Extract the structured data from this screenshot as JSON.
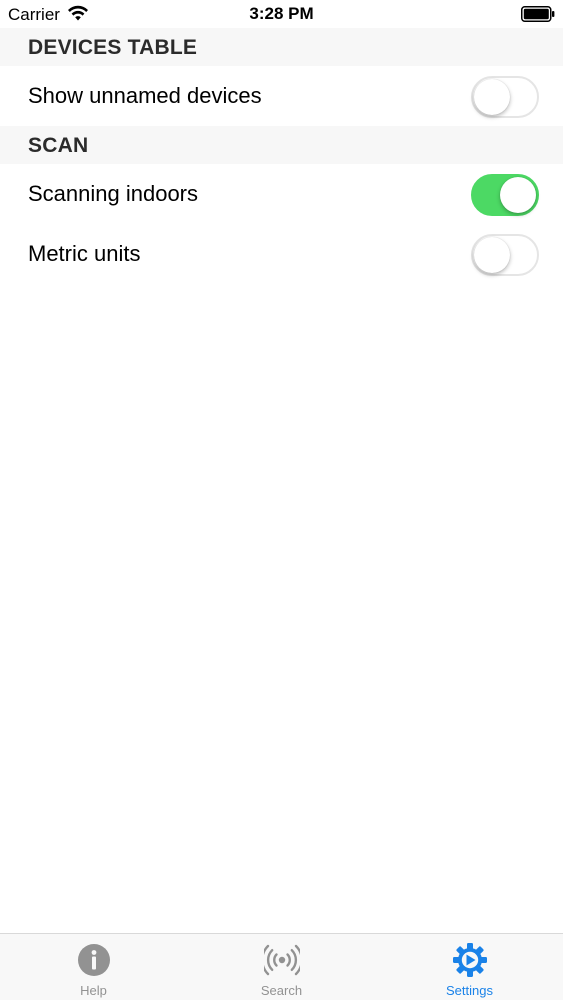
{
  "status_bar": {
    "carrier": "Carrier",
    "time": "3:28 PM",
    "icons": [
      "wifi-icon",
      "battery-icon"
    ]
  },
  "sections": [
    {
      "title": "DEVICES TABLE",
      "rows": [
        {
          "label": "Show unnamed devices",
          "enabled": false
        }
      ]
    },
    {
      "title": "SCAN",
      "rows": [
        {
          "label": "Scanning indoors",
          "enabled": true
        },
        {
          "label": "Metric units",
          "enabled": false
        }
      ]
    }
  ],
  "tab_bar": {
    "selected": "Settings",
    "tabs": [
      {
        "label": "Help",
        "icon": "info-icon"
      },
      {
        "label": "Search",
        "icon": "signal-icon"
      },
      {
        "label": "Settings",
        "icon": "gear-icon"
      }
    ]
  },
  "colors": {
    "toggle_on": "#4cd964",
    "tab_active": "#1a82e8",
    "tab_inactive": "#929292",
    "section_background": "#f7f7f7"
  }
}
